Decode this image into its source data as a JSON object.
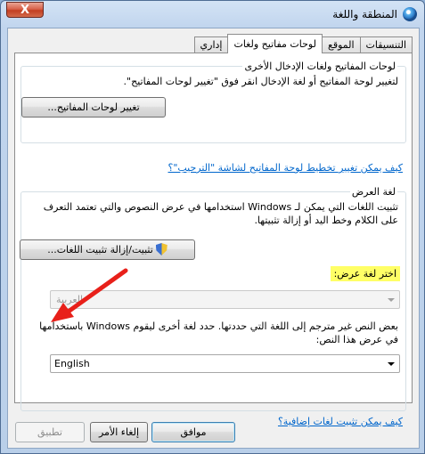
{
  "window": {
    "title": "المنطقة واللغة",
    "close_label": "X"
  },
  "tabs": [
    {
      "label": "التنسيقات"
    },
    {
      "label": "الموقع"
    },
    {
      "label": "لوحات مفاتيح ولغات"
    },
    {
      "label": "إداري"
    }
  ],
  "keyboards_group": {
    "title": "لوحات المفاتيح ولغات الإدخال الأخرى",
    "description": "لتغيير لوحة المفاتيح أو لغة الإدخال انقر فوق \"تغيير لوحات المفاتيح\".",
    "button_label": "تغيير لوحات المفاتيح...",
    "link_text": "كيف يمكن تغيير تخطيط لوحة المفاتيح لشاشة \"الترحيب\"؟"
  },
  "display_group": {
    "title": "لغة العرض",
    "description": "تثبيت اللغات التي يمكن لـ Windows استخدامها في عرض النصوص والتي تعتمد التعرف على الكلام وخط اليد أو إزالة تثبيتها.",
    "install_button_label": "تثبيت/إزالة تثبيت اللغات...",
    "choose_label": "اختر لغة عرض:",
    "display_language_value": "العربية",
    "nonunicode_description": "بعض النص غير مترجم إلى اللغة التي حددتها. حدد لغة أخرى ليقوم Windows باستخدامها في عرض هذا النص:",
    "nonunicode_value": "English"
  },
  "link_bottom": "كيف يمكن تثبيت لغات إضافية؟",
  "footer": {
    "ok_label": "موافق",
    "cancel_label": "إلغاء الأمر",
    "apply_label": "تطبيق"
  },
  "colors": {
    "highlight": "#ffff66",
    "arrow": "#e8201a",
    "link": "#0066cc"
  },
  "icons": {
    "app": "globe-icon",
    "install": "shield-icon"
  }
}
